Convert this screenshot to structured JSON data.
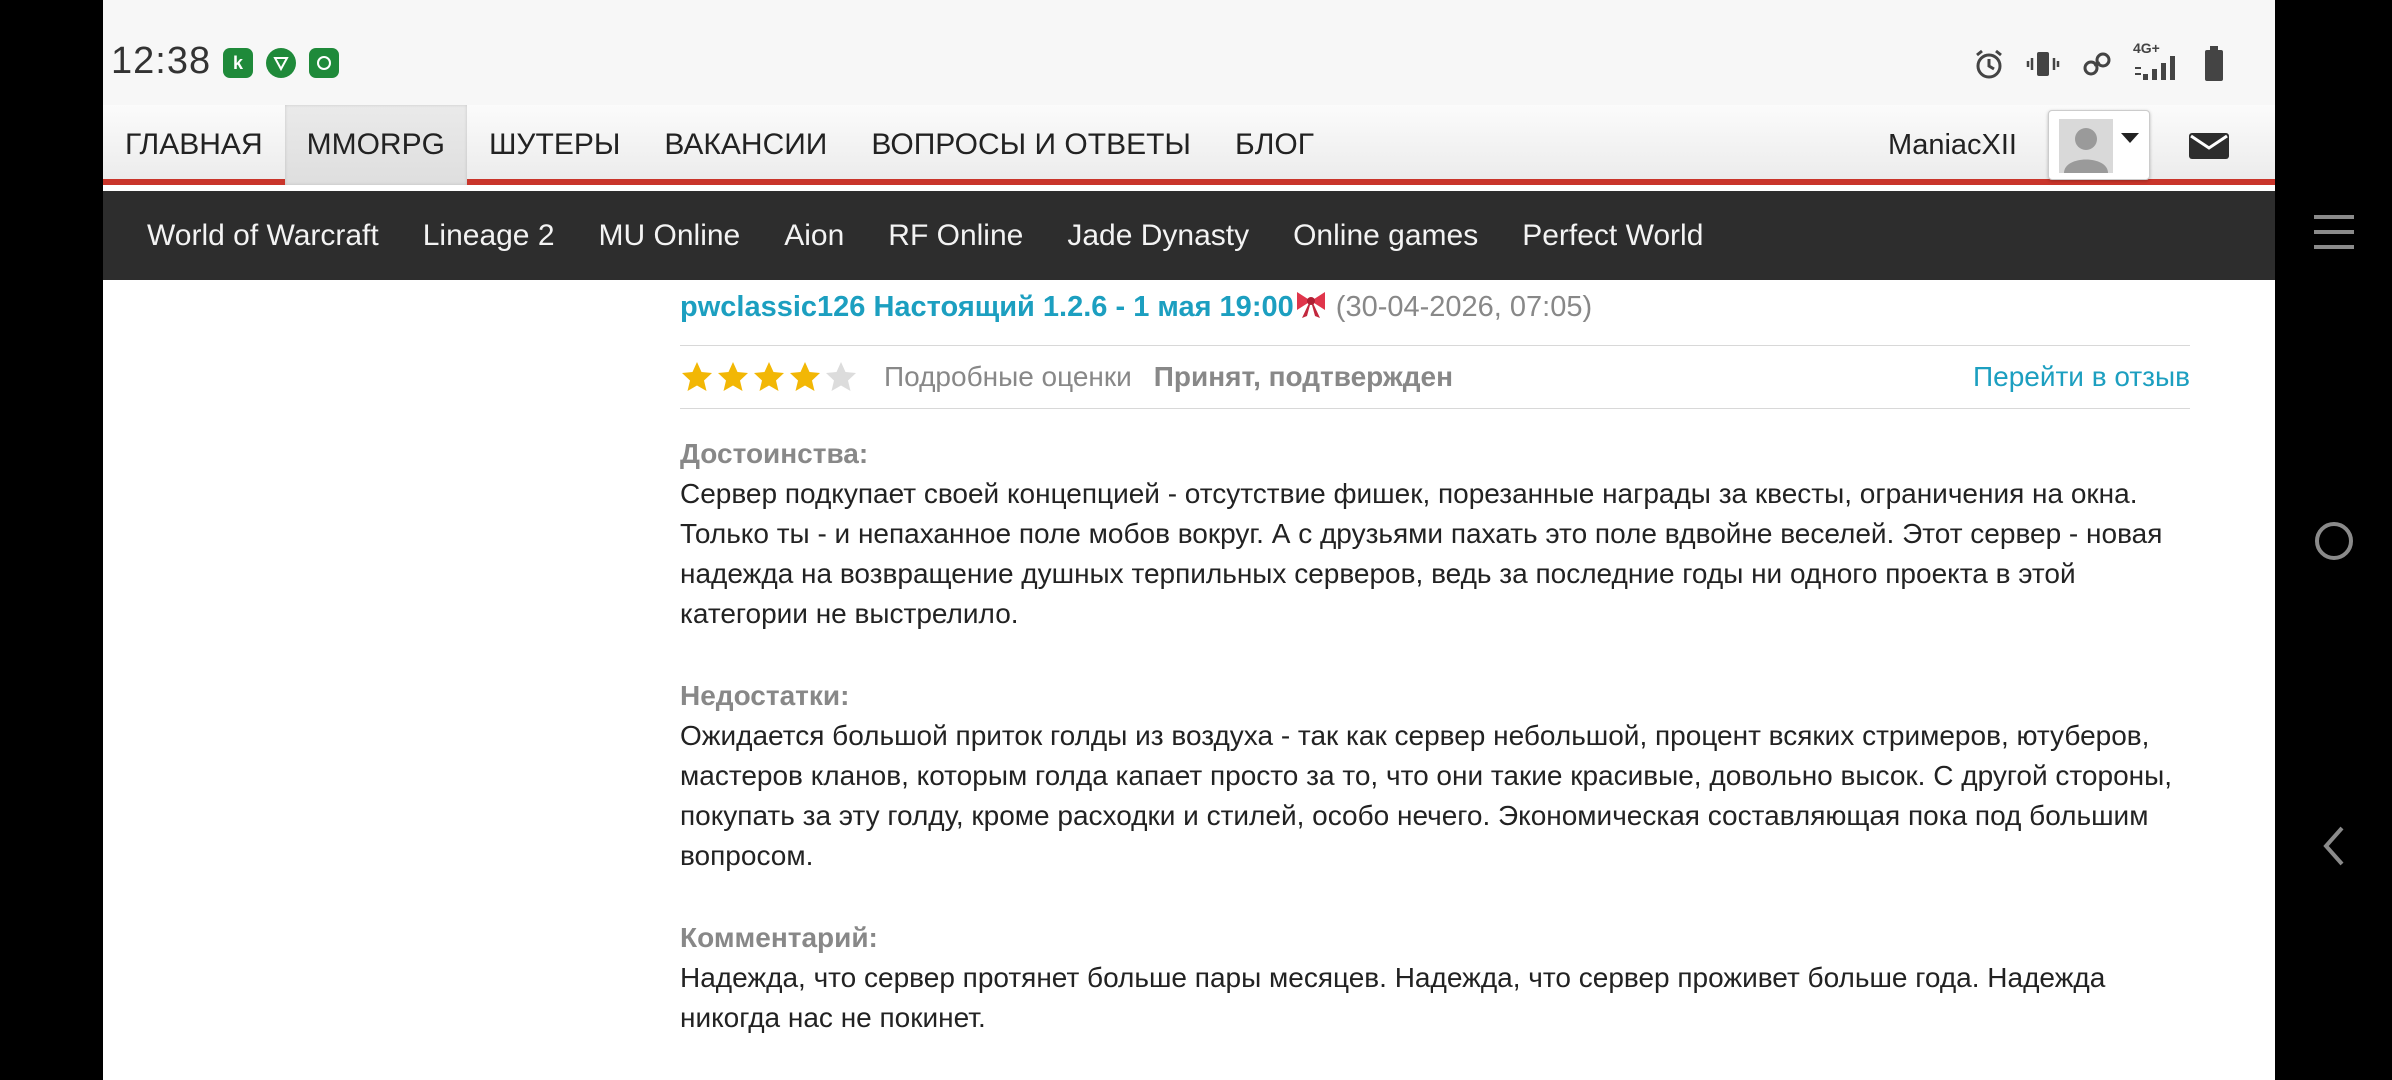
{
  "status_bar": {
    "time": "12:38",
    "app_icons": [
      "k-app-icon",
      "shield-app-icon",
      "bubble-app-icon"
    ],
    "network_label": "4G+",
    "indicators": [
      "alarm-icon",
      "vibrate-icon",
      "link-icon",
      "signal-icon",
      "battery-icon"
    ]
  },
  "nav": {
    "items": [
      {
        "label": "ГЛАВНАЯ",
        "active": false
      },
      {
        "label": "MMORPG",
        "active": true
      },
      {
        "label": "ШУТЕРЫ",
        "active": false
      },
      {
        "label": "ВАКАНСИИ",
        "active": false
      },
      {
        "label": "ВОПРОСЫ И ОТВЕТЫ",
        "active": false
      },
      {
        "label": "БЛОГ",
        "active": false
      }
    ],
    "username": "ManiacXII"
  },
  "subnav": {
    "items": [
      "World of Warcraft",
      "Lineage 2",
      "MU Online",
      "Aion",
      "RF Online",
      "Jade Dynasty",
      "Online games",
      "Perfect World"
    ]
  },
  "review": {
    "title": "pwclassic126 Настоящий 1.2.6 - 1 мая 19:00",
    "title_emoji": "ribbon-bow",
    "date": "(30-04-2026, 07:05)",
    "rating": 4,
    "rating_max": 5,
    "detail_link": "Подробные оценки",
    "status": "Принят, подтвержден",
    "goto_link": "Перейти в отзыв",
    "pros_label": "Достоинства:",
    "pros": "Сервер подкупает своей концепцией - отсутствие фишек, порезанные награды за квесты, ограничения на окна. Только ты - и непаханное поле мобов вокруг. А с друзьями пахать это поле вдвойне веселей. Этот сервер - новая надежда на возвращение душных терпильных серверов, ведь за последние годы ни одного проекта в этой категории не выстрелило.",
    "cons_label": "Недостатки:",
    "cons": "Ожидается большой приток голды из воздуха - так как сервер небольшой, процент всяких стримеров, ютуберов, мастеров кланов, которым голда капает просто за то, что они такие красивые, довольно высок. С другой стороны, покупать за эту голду, кроме расходки и стилей, особо нечего. Экономическая составляющая пока под большим вопросом.",
    "comment_label": "Комментарий:",
    "comment": "Надежда, что сервер протянет больше пары месяцев. Надежда, что сервер проживет больше года. Надежда никогда нас не покинет."
  },
  "colors": {
    "accent_red": "#c9352b",
    "link_blue": "#1c9fc0",
    "subnav_bg": "#2d2d2d",
    "star_gold": "#f2b705"
  },
  "system_nav": [
    "menu-icon",
    "home-icon",
    "back-icon"
  ]
}
